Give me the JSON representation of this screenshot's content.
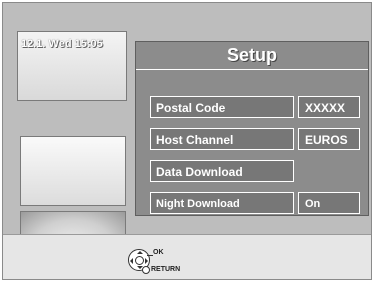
{
  "datetime": "12.1. Wed  15:05",
  "setup": {
    "title": "Setup",
    "items": [
      {
        "label": "Postal Code",
        "value": "XXXXX"
      },
      {
        "label": "Host Channel",
        "value": "EUROS"
      },
      {
        "label": "Data Download",
        "value": ""
      },
      {
        "label": "Night Download",
        "value": "On"
      }
    ]
  },
  "footer": {
    "ok_label": "OK",
    "return_label": "RETURN"
  },
  "icons": {
    "nav": "directional-pad-icon",
    "return": "return-circle-icon"
  }
}
